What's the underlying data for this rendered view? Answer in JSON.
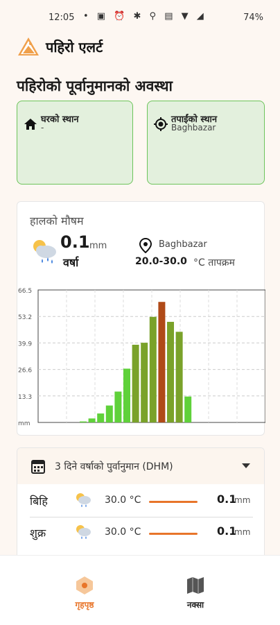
{
  "status_bar": {
    "time": "12:05",
    "battery": "74%",
    "icons": "• ▣ ⏰ ✱ ⚲ ▤ ▼ ◢"
  },
  "app": {
    "title": "पहिरो एलर्ट"
  },
  "section_title": "पहिरोको पूर्वानुमानको अवस्था",
  "locations": [
    {
      "label": "घरको स्थान",
      "value": "-",
      "icon": "home-icon"
    },
    {
      "label": "तपाईंको स्थान",
      "value": "Baghbazar",
      "icon": "gps-icon"
    }
  ],
  "weather": {
    "title": "हालको मौषम",
    "rain_value": "0.1",
    "rain_unit": "mm",
    "rain_label": "वर्षा",
    "place": "Baghbazar",
    "temp_range": "20.0-30.0",
    "temp_label": "°C तापक्रम"
  },
  "chart_data": {
    "type": "bar",
    "y_ticks": [
      "66.5",
      "53.2",
      "39.9",
      "26.6",
      "13.3",
      "mm"
    ],
    "ylim": [
      0,
      66.5
    ],
    "values": [
      0,
      0,
      0,
      0,
      0,
      0,
      0,
      0,
      0,
      0,
      0.5,
      2,
      4.5,
      8.5,
      15.5,
      27,
      39,
      40,
      53,
      60.5,
      50.5,
      45.5,
      13
    ],
    "colors_low": "#5fd13a",
    "colors_high": "#b04a18"
  },
  "forecast": {
    "title": "3 दिने वर्षाको पुर्वानुमान (DHM)",
    "rows": [
      {
        "day": "बिहि",
        "temp": "30.0 °C",
        "rain": "0.1",
        "unit": "mm"
      },
      {
        "day": "शुक्र",
        "temp": "30.0 °C",
        "rain": "0.1",
        "unit": "mm"
      }
    ]
  },
  "nav": {
    "home": "गृहपृष्ठ",
    "map": "नक्सा"
  },
  "accent": "#f0a04b"
}
